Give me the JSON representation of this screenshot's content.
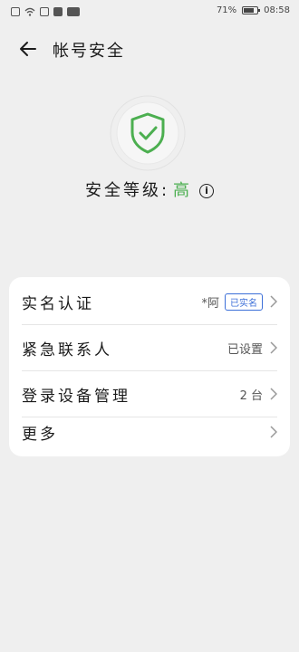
{
  "status_bar": {
    "battery": "71%",
    "time": "08:58"
  },
  "header": {
    "title": "帐号安全"
  },
  "security": {
    "label": "安全等级:",
    "value": "高",
    "info_glyph": "i"
  },
  "colors": {
    "accent_green": "#4caf50",
    "badge_blue": "#3c6fd8"
  },
  "menu": [
    {
      "label": "实名认证",
      "value": "*阿",
      "badge": "已实名"
    },
    {
      "label": "紧急联系人",
      "value": "已设置"
    },
    {
      "label": "登录设备管理",
      "value": "2 台"
    },
    {
      "label": "更多",
      "value": ""
    }
  ]
}
